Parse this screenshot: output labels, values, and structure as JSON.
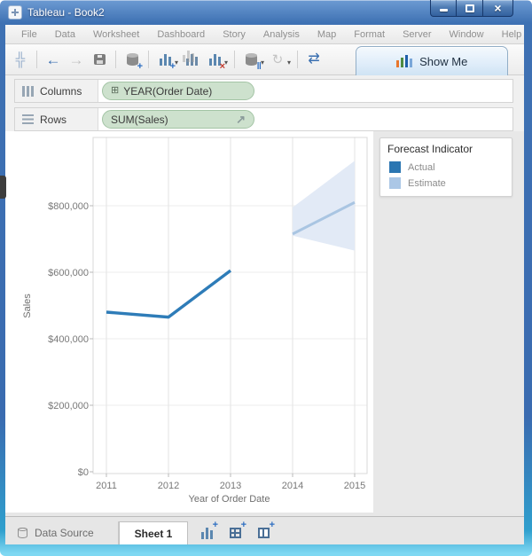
{
  "window": {
    "title": "Tableau - Book2",
    "controls": [
      {
        "name": "minimize-button",
        "shape": "min"
      },
      {
        "name": "maximize-button",
        "shape": "max"
      },
      {
        "name": "close-button",
        "glyph": "×"
      }
    ]
  },
  "menubar": {
    "items": [
      "File",
      "Data",
      "Worksheet",
      "Dashboard",
      "Story",
      "Analysis",
      "Map",
      "Format",
      "Server",
      "Window",
      "Help"
    ]
  },
  "toolbar": {
    "show_me_label": "Show Me",
    "icons": [
      {
        "name": "tableau-logo-icon",
        "glyph": "╬",
        "color": "#96aecb",
        "size": 15
      },
      {
        "sep": true
      },
      {
        "name": "undo-icon",
        "glyph": "←",
        "color": "#3a6fb0",
        "size": 17
      },
      {
        "name": "redo-icon",
        "glyph": "→",
        "color": "#c2c2c2",
        "size": 17
      },
      {
        "name": "save-icon",
        "shape": "i-save"
      },
      {
        "sep": true
      },
      {
        "name": "add-datasource-icon",
        "shape": "i-db",
        "badge": "+",
        "badgeColor": "#2f6fc1"
      },
      {
        "sep": true
      },
      {
        "name": "new-worksheet-icon",
        "shape": "i-bars",
        "badge": "+",
        "badgeColor": "#2f6fc1",
        "caret": true
      },
      {
        "name": "duplicate-sheet-icon",
        "shape": "i-bars2"
      },
      {
        "name": "clear-sheet-icon",
        "shape": "i-bars",
        "badge": "×",
        "badgeColor": "#c23b2e",
        "caret": true
      },
      {
        "sep": true
      },
      {
        "name": "pause-updates-icon",
        "shape": "i-db",
        "badge": "‖",
        "badgeColor": "#2f6fc1",
        "caret": true
      },
      {
        "name": "refresh-icon",
        "glyph": "↻",
        "color": "#c4c4c4",
        "size": 15,
        "caret": true
      },
      {
        "sep": true
      },
      {
        "name": "swap-axes-icon",
        "glyph": "⇄",
        "color": "#3a6fb0",
        "size": 16
      }
    ]
  },
  "shelves": {
    "columns_label": "Columns",
    "rows_label": "Rows",
    "columns_pill": "YEAR(Order Date)",
    "columns_pill_icon": "⊞",
    "rows_pill": "SUM(Sales)",
    "rows_pill_icon": "↗"
  },
  "tabs": {
    "data_source": "Data Source",
    "sheet": "Sheet 1",
    "actions": [
      {
        "name": "new-worksheet-tab-icon",
        "shape": "i-bars",
        "badge": "+",
        "badgeColor": "#2f6fc1"
      },
      {
        "name": "new-dashboard-tab-icon",
        "shape": "i-grid",
        "badge": "+",
        "badgeColor": "#2f6fc1"
      },
      {
        "name": "new-story-tab-icon",
        "shape": "i-book",
        "badge": "+",
        "badgeColor": "#2f6fc1"
      }
    ]
  },
  "chart_data": {
    "type": "line",
    "title": "",
    "xlabel": "Year of Order Date",
    "ylabel": "Sales",
    "x_ticks": [
      2011,
      2012,
      2013,
      2014,
      2015
    ],
    "y_ticks": [
      {
        "value": 0,
        "label": "$0"
      },
      {
        "value": 200000,
        "label": "$200,000"
      },
      {
        "value": 400000,
        "label": "$400,000"
      },
      {
        "value": 600000,
        "label": "$600,000"
      },
      {
        "value": 800000,
        "label": "$800,000"
      }
    ],
    "ylim": [
      0,
      1010000
    ],
    "xlim": [
      2010.8,
      2015.2
    ],
    "grid": true,
    "series": [
      {
        "name": "Actual",
        "color": "#2e7cb8",
        "points": [
          {
            "x": 2011,
            "y": 480000
          },
          {
            "x": 2012,
            "y": 465000
          },
          {
            "x": 2013,
            "y": 605000
          }
        ]
      },
      {
        "name": "Estimate",
        "color": "#a9c5e2",
        "points": [
          {
            "x": 2014,
            "y": 715000
          },
          {
            "x": 2015,
            "y": 810000
          }
        ]
      }
    ],
    "band": {
      "name": "Estimate interval",
      "fill": "#e2eaf6",
      "points": [
        {
          "x": 2014,
          "upper": 795000,
          "lower": 710000
        },
        {
          "x": 2015,
          "upper": 935000,
          "lower": 665000
        }
      ]
    },
    "legend": {
      "title": "Forecast Indicator",
      "position": "right",
      "items": [
        {
          "label": "Actual",
          "color": "#2b76b2"
        },
        {
          "label": "Estimate",
          "color": "#abc7e6"
        }
      ]
    }
  }
}
